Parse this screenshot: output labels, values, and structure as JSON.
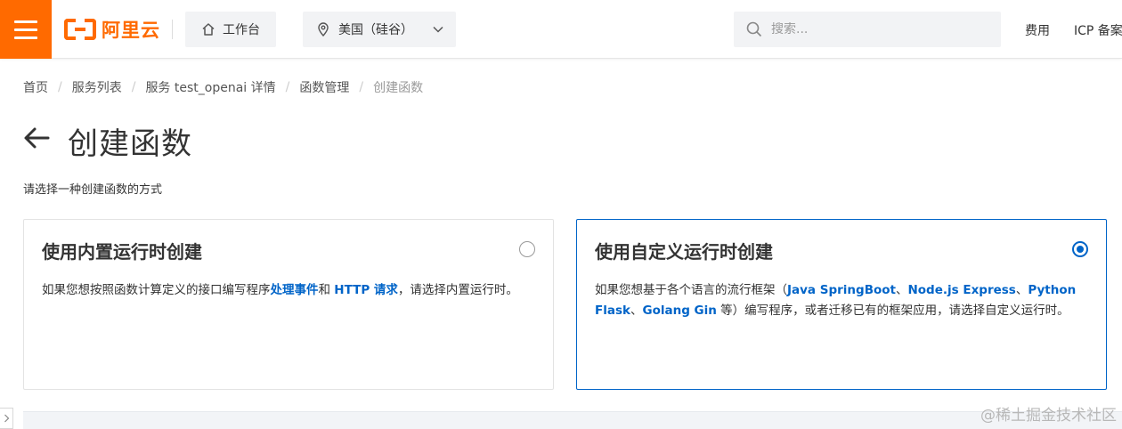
{
  "header": {
    "logo_text": "阿里云",
    "workbench_label": "工作台",
    "region_label": "美国（硅谷）",
    "search_placeholder": "搜索...",
    "nav": [
      "费用",
      "ICP 备案"
    ]
  },
  "breadcrumb": [
    {
      "label": "首页"
    },
    {
      "label": "服务列表"
    },
    {
      "label": "服务 test_openai 详情"
    },
    {
      "label": "函数管理"
    },
    {
      "label": "创建函数"
    }
  ],
  "page": {
    "title": "创建函数",
    "subtitle": "请选择一种创建函数的方式"
  },
  "options": [
    {
      "title": "使用内置运行时创建",
      "selected": false,
      "desc": [
        {
          "text": "如果您想按照函数计算定义的接口编写程序",
          "hl": false
        },
        {
          "text": "处理事件",
          "hl": true
        },
        {
          "text": "和 ",
          "hl": false
        },
        {
          "text": "HTTP 请求",
          "hl": true
        },
        {
          "text": "，请选择内置运行时。",
          "hl": false
        }
      ]
    },
    {
      "title": "使用自定义运行时创建",
      "selected": true,
      "desc": [
        {
          "text": "如果您想基于各个语言的流行框架（",
          "hl": false
        },
        {
          "text": "Java SpringBoot",
          "hl": true
        },
        {
          "text": "、",
          "hl": false
        },
        {
          "text": "Node.js Express",
          "hl": true
        },
        {
          "text": "、",
          "hl": false
        },
        {
          "text": "Python Flask",
          "hl": true
        },
        {
          "text": "、",
          "hl": false
        },
        {
          "text": "Golang Gin",
          "hl": true
        },
        {
          "text": " 等）编写程序，或者迁移已有的框架应用，请选择自定义运行时。",
          "hl": false
        }
      ]
    }
  ],
  "watermark": "@稀土掘金技术社区",
  "colors": {
    "brand": "#ff6a00",
    "link": "#0064c8"
  }
}
